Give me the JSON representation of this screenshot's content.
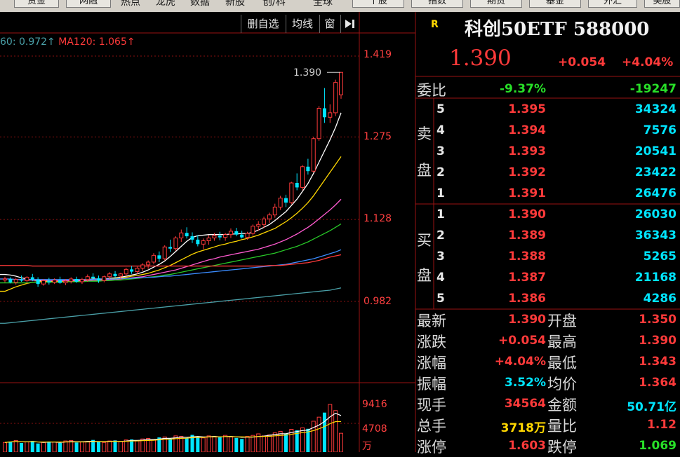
{
  "top_nav": {
    "buttons": [
      "资金",
      "网融",
      "个股",
      "指数",
      "期货",
      "基金",
      "外汇",
      "美股"
    ],
    "text_items": [
      "热点",
      "龙虎",
      "数据",
      "新股",
      "创/科",
      "全球"
    ]
  },
  "chart_toolbar": {
    "buttons": [
      "删自选",
      "均线",
      "窗"
    ],
    "arrow_icon": "collapse-right-icon"
  },
  "ma_legend": {
    "ma60": "60: 0.972↑",
    "ma120": "MA120: 1.065↑"
  },
  "price_axis": [
    "1.419",
    "1.275",
    "1.128",
    "0.982"
  ],
  "volume_axis": [
    "9416",
    "4708",
    "万"
  ],
  "chart_annotation": {
    "high_label": "1.390"
  },
  "colors": {
    "up": "#ff3a3a",
    "down": "#00e5ff",
    "ma_white": "#ffffff",
    "ma_yellow": "#ffd700",
    "ma_magenta": "#ff5ad0",
    "ma_green": "#28c828",
    "ma_blue": "#3a8cff",
    "ma_red": "#ff3a3a",
    "ma_teal": "#4aa0a8",
    "grid": "#8a1010"
  },
  "quote": {
    "r_badge": "R",
    "title": "科创50ETF 588000",
    "price": "1.390",
    "change": "+0.054",
    "change_pct": "+4.04%",
    "weibi": {
      "label": "委比",
      "pct": "-9.37%",
      "diff": "-19247"
    },
    "sell": {
      "label_top": "卖",
      "label_bottom": "盘",
      "rows": [
        {
          "level": "5",
          "price": "1.395",
          "vol": "34324"
        },
        {
          "level": "4",
          "price": "1.394",
          "vol": "7576"
        },
        {
          "level": "3",
          "price": "1.393",
          "vol": "20541"
        },
        {
          "level": "2",
          "price": "1.392",
          "vol": "23422"
        },
        {
          "level": "1",
          "price": "1.391",
          "vol": "26476"
        }
      ]
    },
    "buy": {
      "label_top": "买",
      "label_bottom": "盘",
      "rows": [
        {
          "level": "1",
          "price": "1.390",
          "vol": "26030"
        },
        {
          "level": "2",
          "price": "1.389",
          "vol": "36343"
        },
        {
          "level": "3",
          "price": "1.388",
          "vol": "5265"
        },
        {
          "level": "4",
          "price": "1.387",
          "vol": "21168"
        },
        {
          "level": "5",
          "price": "1.386",
          "vol": "4286"
        }
      ]
    },
    "stats": [
      {
        "l1": "最新",
        "v1": "1.390",
        "c1": "red",
        "l2": "开盘",
        "v2": "1.350",
        "c2": "red"
      },
      {
        "l1": "涨跌",
        "v1": "+0.054",
        "c1": "red",
        "l2": "最高",
        "v2": "1.390",
        "c2": "red"
      },
      {
        "l1": "涨幅",
        "v1": "+4.04%",
        "c1": "red",
        "l2": "最低",
        "v2": "1.343",
        "c2": "red"
      },
      {
        "l1": "振幅",
        "v1": "3.52%",
        "c1": "cyan",
        "l2": "均价",
        "v2": "1.364",
        "c2": "red"
      },
      {
        "l1": "现手",
        "v1": "34564",
        "c1": "red",
        "l2": "金额",
        "v2": "50.71亿",
        "c2": "cyan"
      },
      {
        "l1": "总手",
        "v1": "3718万",
        "c1": "yellow",
        "l2": "量比",
        "v2": "1.12",
        "c2": "red"
      },
      {
        "l1": "涨停",
        "v1": "1.603",
        "c1": "red",
        "l2": "跌停",
        "v2": "1.069",
        "c2": "green"
      }
    ]
  },
  "chart_data": {
    "type": "candlestick",
    "y_axis_ticks": [
      1.419,
      1.275,
      1.128,
      0.982
    ],
    "candles": [
      [
        1.02,
        1.026,
        1.016,
        1.022
      ],
      [
        1.022,
        1.025,
        1.014,
        1.016
      ],
      [
        1.016,
        1.024,
        1.012,
        1.021
      ],
      [
        1.021,
        1.028,
        1.017,
        1.019
      ],
      [
        1.019,
        1.027,
        1.014,
        1.025
      ],
      [
        1.025,
        1.031,
        1.018,
        1.021
      ],
      [
        1.021,
        1.025,
        1.008,
        1.013
      ],
      [
        1.013,
        1.022,
        1.01,
        1.019
      ],
      [
        1.019,
        1.024,
        1.012,
        1.016
      ],
      [
        1.016,
        1.023,
        1.013,
        1.02
      ],
      [
        1.02,
        1.026,
        1.013,
        1.015
      ],
      [
        1.015,
        1.022,
        1.011,
        1.018
      ],
      [
        1.018,
        1.025,
        1.014,
        1.022
      ],
      [
        1.022,
        1.026,
        1.015,
        1.017
      ],
      [
        1.017,
        1.024,
        1.013,
        1.021
      ],
      [
        1.021,
        1.03,
        1.017,
        1.026
      ],
      [
        1.026,
        1.032,
        1.02,
        1.023
      ],
      [
        1.023,
        1.028,
        1.015,
        1.019
      ],
      [
        1.019,
        1.028,
        1.016,
        1.026
      ],
      [
        1.026,
        1.034,
        1.022,
        1.031
      ],
      [
        1.031,
        1.036,
        1.024,
        1.027
      ],
      [
        1.027,
        1.033,
        1.022,
        1.031
      ],
      [
        1.031,
        1.042,
        1.027,
        1.039
      ],
      [
        1.039,
        1.045,
        1.031,
        1.035
      ],
      [
        1.035,
        1.044,
        1.03,
        1.041
      ],
      [
        1.041,
        1.05,
        1.036,
        1.047
      ],
      [
        1.047,
        1.055,
        1.04,
        1.052
      ],
      [
        1.052,
        1.068,
        1.048,
        1.064
      ],
      [
        1.064,
        1.071,
        1.052,
        1.058
      ],
      [
        1.058,
        1.082,
        1.055,
        1.079
      ],
      [
        1.079,
        1.092,
        1.07,
        1.076
      ],
      [
        1.076,
        1.098,
        1.072,
        1.095
      ],
      [
        1.095,
        1.11,
        1.088,
        1.104
      ],
      [
        1.104,
        1.114,
        1.094,
        1.098
      ],
      [
        1.098,
        1.105,
        1.086,
        1.092
      ],
      [
        1.092,
        1.1,
        1.08,
        1.084
      ],
      [
        1.084,
        1.094,
        1.075,
        1.09
      ],
      [
        1.09,
        1.1,
        1.083,
        1.095
      ],
      [
        1.095,
        1.104,
        1.09,
        1.099
      ],
      [
        1.099,
        1.106,
        1.091,
        1.096
      ],
      [
        1.096,
        1.104,
        1.09,
        1.101
      ],
      [
        1.101,
        1.112,
        1.095,
        1.107
      ],
      [
        1.107,
        1.113,
        1.098,
        1.101
      ],
      [
        1.101,
        1.108,
        1.094,
        1.096
      ],
      [
        1.096,
        1.106,
        1.092,
        1.103
      ],
      [
        1.103,
        1.119,
        1.099,
        1.116
      ],
      [
        1.116,
        1.125,
        1.108,
        1.119
      ],
      [
        1.119,
        1.133,
        1.113,
        1.129
      ],
      [
        1.129,
        1.14,
        1.122,
        1.136
      ],
      [
        1.136,
        1.156,
        1.131,
        1.15
      ],
      [
        1.15,
        1.17,
        1.145,
        1.166
      ],
      [
        1.166,
        1.172,
        1.15,
        1.158
      ],
      [
        1.158,
        1.195,
        1.155,
        1.193
      ],
      [
        1.193,
        1.21,
        1.18,
        1.185
      ],
      [
        1.185,
        1.225,
        1.18,
        1.222
      ],
      [
        1.222,
        1.236,
        1.208,
        1.214
      ],
      [
        1.214,
        1.275,
        1.212,
        1.272
      ],
      [
        1.272,
        1.33,
        1.268,
        1.326
      ],
      [
        1.326,
        1.362,
        1.3,
        1.31
      ],
      [
        1.31,
        1.333,
        1.3,
        1.318
      ],
      [
        1.318,
        1.377,
        1.312,
        1.372
      ],
      [
        1.35,
        1.39,
        1.343,
        1.39
      ]
    ],
    "ma_lines": [
      {
        "color": "ma_white",
        "values": [
          1.03,
          1.029,
          1.027,
          1.024,
          1.022,
          1.02,
          1.019,
          1.018,
          1.018,
          1.018,
          1.019,
          1.019,
          1.019,
          1.02,
          1.02,
          1.021,
          1.022,
          1.022,
          1.022,
          1.023,
          1.024,
          1.025,
          1.027,
          1.029,
          1.031,
          1.034,
          1.038,
          1.043,
          1.048,
          1.054,
          1.062,
          1.071,
          1.08,
          1.089,
          1.096,
          1.099,
          1.1,
          1.101,
          1.101,
          1.101,
          1.101,
          1.102,
          1.102,
          1.103,
          1.103,
          1.105,
          1.109,
          1.114,
          1.119,
          1.126,
          1.134,
          1.142,
          1.153,
          1.164,
          1.178,
          1.192,
          1.21,
          1.23,
          1.25,
          1.27,
          1.292,
          1.318
        ]
      },
      {
        "color": "ma_yellow",
        "values": [
          1.0,
          1.004,
          1.008,
          1.011,
          1.014,
          1.016,
          1.017,
          1.018,
          1.018,
          1.018,
          1.018,
          1.018,
          1.018,
          1.018,
          1.019,
          1.019,
          1.02,
          1.02,
          1.021,
          1.022,
          1.023,
          1.024,
          1.025,
          1.027,
          1.028,
          1.03,
          1.032,
          1.035,
          1.038,
          1.042,
          1.046,
          1.051,
          1.056,
          1.061,
          1.066,
          1.07,
          1.073,
          1.076,
          1.079,
          1.082,
          1.084,
          1.087,
          1.089,
          1.092,
          1.094,
          1.097,
          1.1,
          1.104,
          1.108,
          1.112,
          1.118,
          1.124,
          1.131,
          1.139,
          1.148,
          1.158,
          1.17,
          1.184,
          1.198,
          1.212,
          1.226,
          1.24
        ]
      },
      {
        "color": "ma_magenta",
        "values": [
          1.022,
          1.022,
          1.021,
          1.021,
          1.02,
          1.02,
          1.02,
          1.02,
          1.019,
          1.019,
          1.019,
          1.019,
          1.019,
          1.019,
          1.019,
          1.019,
          1.02,
          1.02,
          1.02,
          1.021,
          1.021,
          1.022,
          1.023,
          1.024,
          1.025,
          1.026,
          1.028,
          1.03,
          1.032,
          1.034,
          1.036,
          1.038,
          1.041,
          1.044,
          1.047,
          1.05,
          1.053,
          1.056,
          1.058,
          1.061,
          1.063,
          1.065,
          1.067,
          1.069,
          1.071,
          1.073,
          1.075,
          1.078,
          1.081,
          1.084,
          1.088,
          1.092,
          1.097,
          1.102,
          1.108,
          1.114,
          1.121,
          1.129,
          1.137,
          1.145,
          1.154,
          1.164
        ]
      },
      {
        "color": "ma_green",
        "values": [
          1.015,
          1.015,
          1.015,
          1.015,
          1.015,
          1.016,
          1.016,
          1.016,
          1.016,
          1.016,
          1.016,
          1.017,
          1.017,
          1.017,
          1.017,
          1.018,
          1.018,
          1.018,
          1.019,
          1.019,
          1.02,
          1.02,
          1.021,
          1.022,
          1.023,
          1.024,
          1.025,
          1.026,
          1.027,
          1.029,
          1.03,
          1.032,
          1.034,
          1.036,
          1.038,
          1.04,
          1.042,
          1.044,
          1.046,
          1.048,
          1.05,
          1.052,
          1.054,
          1.056,
          1.058,
          1.06,
          1.062,
          1.064,
          1.066,
          1.068,
          1.071,
          1.074,
          1.077,
          1.08,
          1.084,
          1.088,
          1.093,
          1.098,
          1.103,
          1.108,
          1.114,
          1.12
        ]
      },
      {
        "color": "ma_blue",
        "values": [
          1.022,
          1.022,
          1.021,
          1.021,
          1.021,
          1.021,
          1.021,
          1.021,
          1.021,
          1.021,
          1.021,
          1.021,
          1.021,
          1.021,
          1.021,
          1.021,
          1.021,
          1.022,
          1.022,
          1.022,
          1.022,
          1.023,
          1.023,
          1.023,
          1.024,
          1.024,
          1.025,
          1.025,
          1.026,
          1.027,
          1.027,
          1.028,
          1.029,
          1.03,
          1.031,
          1.032,
          1.033,
          1.034,
          1.035,
          1.036,
          1.037,
          1.038,
          1.039,
          1.04,
          1.041,
          1.042,
          1.043,
          1.044,
          1.045,
          1.046,
          1.047,
          1.048,
          1.05,
          1.052,
          1.054,
          1.056,
          1.058,
          1.061,
          1.064,
          1.067,
          1.07,
          1.074
        ]
      },
      {
        "color": "ma_red",
        "values": [
          1.046,
          1.046,
          1.046,
          1.046,
          1.046,
          1.045,
          1.045,
          1.045,
          1.045,
          1.045,
          1.045,
          1.045,
          1.045,
          1.045,
          1.045,
          1.045,
          1.045,
          1.045,
          1.045,
          1.045,
          1.045,
          1.045,
          1.045,
          1.045,
          1.045,
          1.045,
          1.045,
          1.045,
          1.045,
          1.045,
          1.045,
          1.045,
          1.045,
          1.045,
          1.045,
          1.045,
          1.045,
          1.045,
          1.045,
          1.045,
          1.045,
          1.045,
          1.045,
          1.045,
          1.045,
          1.045,
          1.045,
          1.045,
          1.046,
          1.046,
          1.046,
          1.047,
          1.048,
          1.049,
          1.05,
          1.051,
          1.053,
          1.055,
          1.058,
          1.061,
          1.063,
          1.065
        ]
      },
      {
        "color": "ma_teal",
        "values": [
          0.943,
          0.944,
          0.945,
          0.946,
          0.947,
          0.948,
          0.949,
          0.95,
          0.951,
          0.952,
          0.953,
          0.954,
          0.955,
          0.956,
          0.957,
          0.958,
          0.959,
          0.96,
          0.961,
          0.962,
          0.963,
          0.964,
          0.965,
          0.966,
          0.967,
          0.968,
          0.969,
          0.97,
          0.971,
          0.972,
          0.973,
          0.974,
          0.975,
          0.976,
          0.977,
          0.978,
          0.979,
          0.98,
          0.981,
          0.982,
          0.983,
          0.984,
          0.985,
          0.986,
          0.987,
          0.988,
          0.989,
          0.99,
          0.991,
          0.992,
          0.993,
          0.994,
          0.995,
          0.996,
          0.997,
          0.998,
          0.999,
          1.0,
          1.001,
          1.002,
          1.004,
          1.006
        ]
      }
    ],
    "volume_wan": [
      1900,
      2100,
      2300,
      1800,
      2000,
      2200,
      1700,
      1900,
      2100,
      2000,
      1800,
      2200,
      2300,
      1900,
      2000,
      2100,
      2400,
      2000,
      1900,
      2200,
      2300,
      2100,
      2400,
      2500,
      2200,
      2600,
      2700,
      2400,
      2900,
      3000,
      2600,
      3200,
      3100,
      2700,
      3400,
      3000,
      2800,
      3200,
      3100,
      2900,
      3300,
      3000,
      2800,
      2600,
      3100,
      3300,
      3600,
      3200,
      3400,
      3800,
      4100,
      3600,
      4500,
      4300,
      4800,
      4600,
      6100,
      6900,
      7800,
      9416,
      8200,
      3718
    ],
    "volume_up": [
      true,
      false,
      true,
      false,
      true,
      false,
      false,
      true,
      false,
      true,
      false,
      true,
      true,
      false,
      true,
      true,
      false,
      false,
      true,
      true,
      false,
      true,
      true,
      false,
      true,
      true,
      true,
      true,
      false,
      true,
      false,
      true,
      true,
      false,
      false,
      false,
      true,
      true,
      true,
      false,
      true,
      true,
      false,
      false,
      true,
      true,
      true,
      true,
      true,
      true,
      true,
      false,
      true,
      false,
      true,
      false,
      true,
      true,
      false,
      true,
      true,
      true
    ]
  }
}
